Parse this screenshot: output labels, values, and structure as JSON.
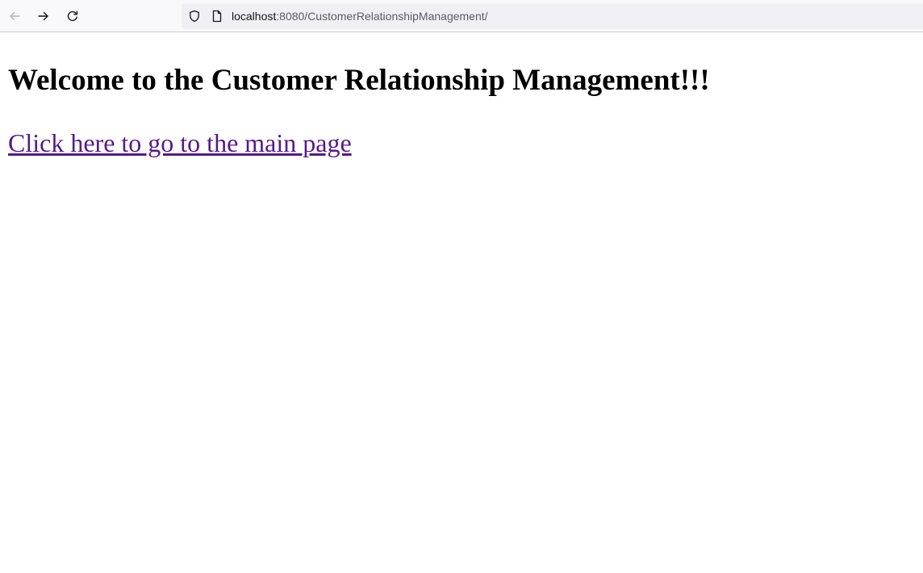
{
  "browser": {
    "url_host": "localhost",
    "url_rest": ":8080/CustomerRelationshipManagement/",
    "icons": {
      "back": "back-arrow-icon",
      "forward": "forward-arrow-icon",
      "reload": "reload-icon",
      "shield": "shield-icon",
      "page": "page-icon"
    }
  },
  "page": {
    "heading": "Welcome to the Customer Relationship Management!!!",
    "link_text": "Click here to go to the main page",
    "colors": {
      "link_visited": "#551a8b",
      "heading": "#000000"
    }
  }
}
